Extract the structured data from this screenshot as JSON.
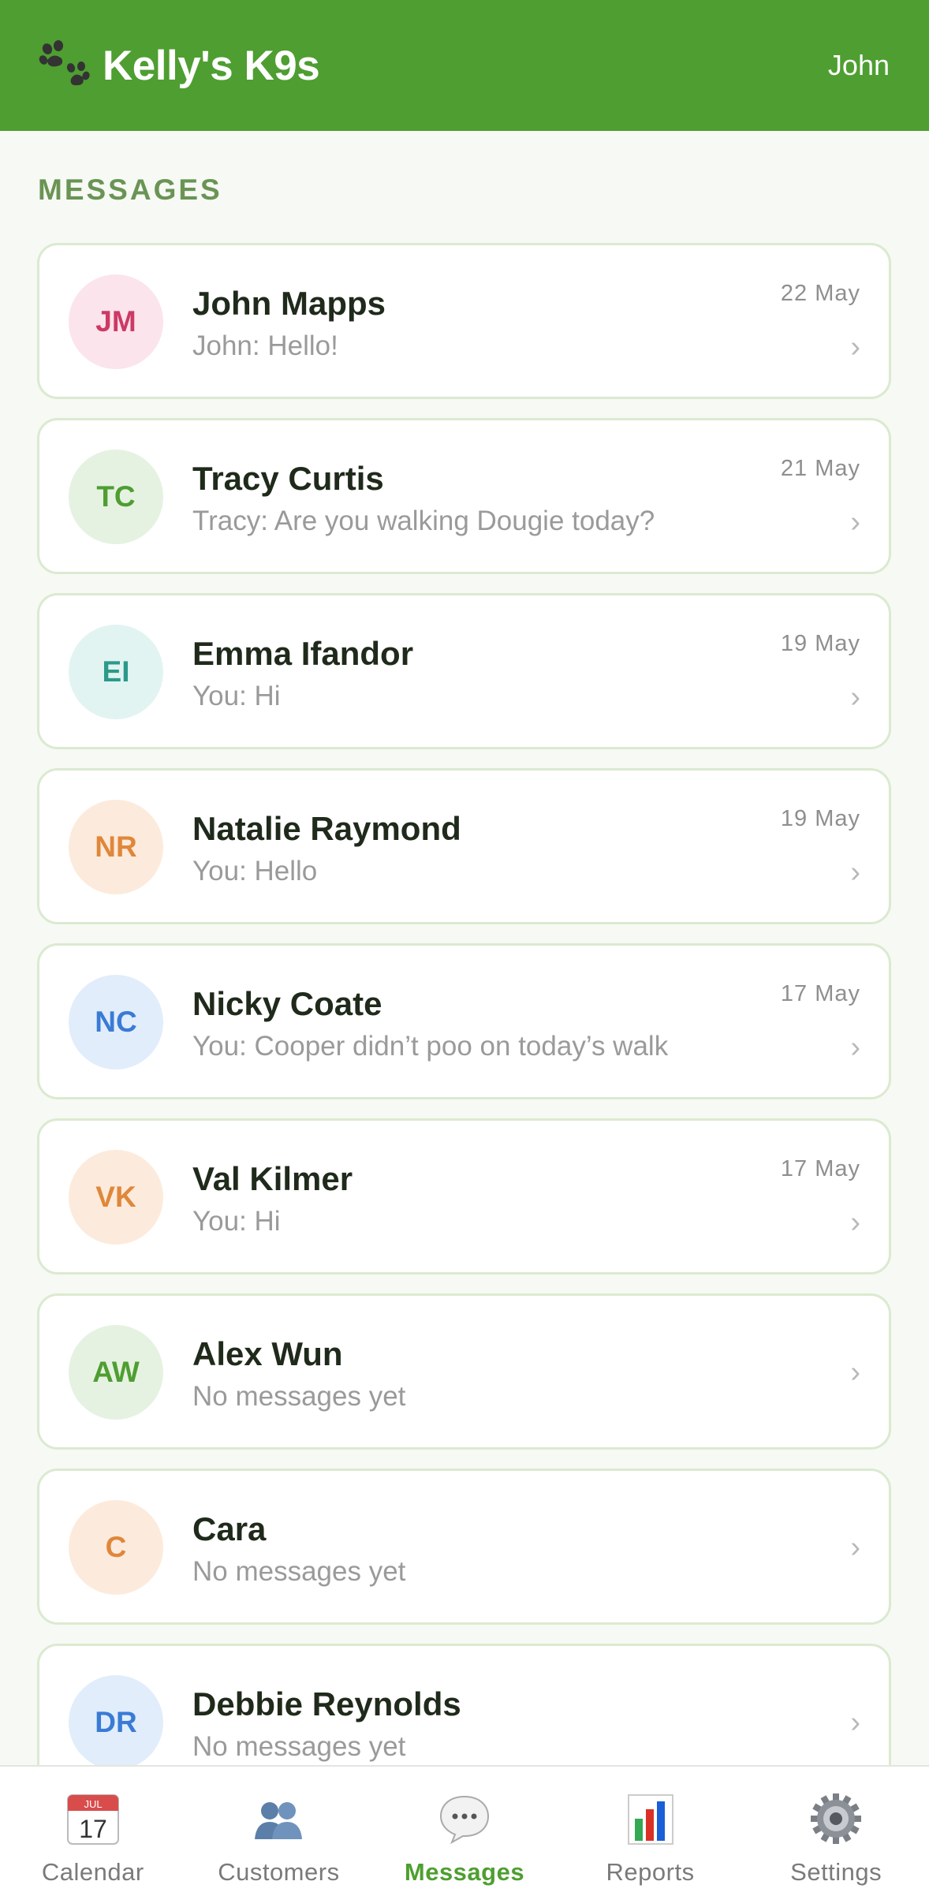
{
  "header": {
    "brand": "Kelly's K9s",
    "user": "John",
    "logo_icon": "paw-icon"
  },
  "section_title": "MESSAGES",
  "conversations": [
    {
      "initials": "JM",
      "name": "John Mapps",
      "preview": "John: Hello!",
      "date": "22 May",
      "bg": "#fbe4ec",
      "fg": "#cc3a66"
    },
    {
      "initials": "TC",
      "name": "Tracy Curtis",
      "preview": "Tracy: Are you walking Dougie today?",
      "date": "21 May",
      "bg": "#e6f2e1",
      "fg": "#4e9e31"
    },
    {
      "initials": "EI",
      "name": "Emma Ifandor",
      "preview": "You: Hi",
      "date": "19 May",
      "bg": "#e2f4f1",
      "fg": "#2b9a8a"
    },
    {
      "initials": "NR",
      "name": "Natalie Raymond",
      "preview": "You: Hello",
      "date": "19 May",
      "bg": "#fcebdc",
      "fg": "#e0873a"
    },
    {
      "initials": "NC",
      "name": "Nicky Coate",
      "preview": "You: Cooper didn’t poo on today’s walk",
      "date": "17 May",
      "bg": "#e2edfb",
      "fg": "#3a7bd5"
    },
    {
      "initials": "VK",
      "name": "Val Kilmer",
      "preview": "You: Hi",
      "date": "17 May",
      "bg": "#fcebdc",
      "fg": "#e0873a"
    },
    {
      "initials": "AW",
      "name": "Alex Wun",
      "preview": "No messages yet",
      "date": "",
      "bg": "#e6f2e1",
      "fg": "#4e9e31"
    },
    {
      "initials": "C",
      "name": "Cara",
      "preview": "No messages yet",
      "date": "",
      "bg": "#fcebdc",
      "fg": "#e0873a"
    },
    {
      "initials": "DR",
      "name": "Debbie Reynolds",
      "preview": "No messages yet",
      "date": "",
      "bg": "#e2edfb",
      "fg": "#3a7bd5"
    }
  ],
  "tabs": [
    {
      "label": "Calendar",
      "icon": "calendar-icon",
      "icon_month": "JUL",
      "icon_day": "17",
      "active": false
    },
    {
      "label": "Customers",
      "icon": "customers-icon",
      "active": false
    },
    {
      "label": "Messages",
      "icon": "messages-icon",
      "active": true
    },
    {
      "label": "Reports",
      "icon": "reports-icon",
      "active": false
    },
    {
      "label": "Settings",
      "icon": "settings-icon",
      "active": false
    }
  ],
  "colors": {
    "brand_green": "#4e9e31",
    "section_title": "#6a9455",
    "card_border": "#dbead0"
  }
}
